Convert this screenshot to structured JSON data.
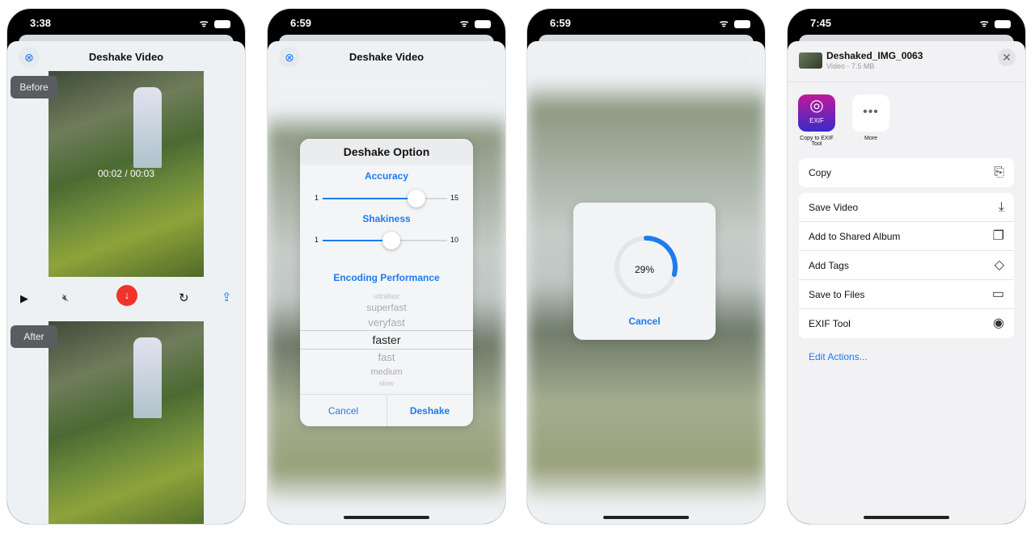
{
  "screens": [
    {
      "time": "3:38",
      "title": "Deshake Video",
      "before_label": "Before",
      "after_label": "After",
      "timecode": "00:02 / 00:03"
    },
    {
      "time": "6:59",
      "title": "Deshake Video",
      "dialog": {
        "title": "Deshake Option",
        "accuracy_label": "Accuracy",
        "accuracy_min": "1",
        "accuracy_max": "15",
        "accuracy_value": 12,
        "shakiness_label": "Shakiness",
        "shakiness_min": "1",
        "shakiness_max": "10",
        "shakiness_value": 6,
        "encoding_label": "Encoding Performance",
        "options": [
          "ultrafast",
          "superfast",
          "veryfast",
          "faster",
          "fast",
          "medium",
          "slow"
        ],
        "selected": "faster",
        "cancel": "Cancel",
        "confirm": "Deshake"
      }
    },
    {
      "time": "6:59",
      "progress": {
        "percent_label": "29%",
        "value": 0.29,
        "cancel": "Cancel"
      }
    },
    {
      "time": "7:45",
      "share": {
        "file_name": "Deshaked_IMG_0063",
        "file_meta": "Video · 7.5 MB",
        "apps": [
          {
            "label": "Copy to EXIF Tool",
            "icon_text": "EXIF"
          },
          {
            "label": "More"
          }
        ],
        "copy": "Copy",
        "actions": [
          "Save Video",
          "Add to Shared Album",
          "Add Tags",
          "Save to Files",
          "EXIF Tool"
        ],
        "edit": "Edit Actions..."
      }
    }
  ],
  "colors": {
    "accent": "#1a7cf0",
    "record": "#f0332b"
  }
}
